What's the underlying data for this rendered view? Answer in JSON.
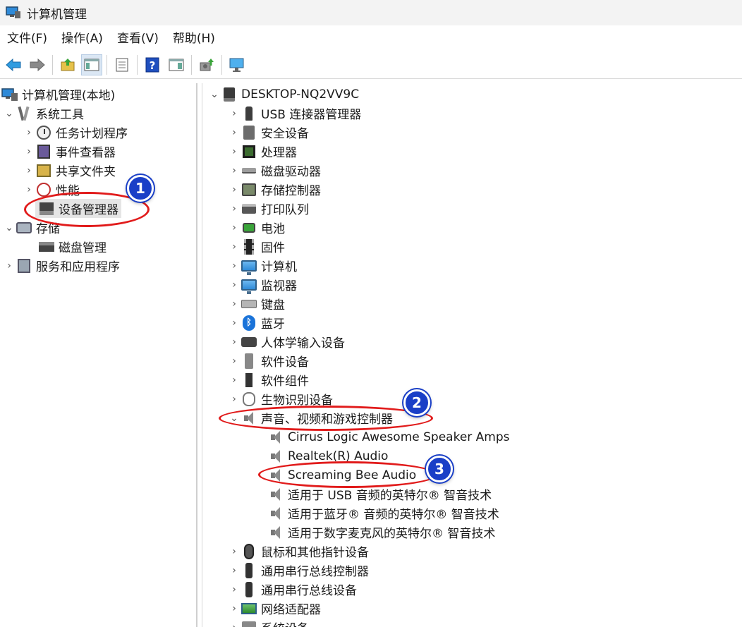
{
  "window": {
    "title": "计算机管理"
  },
  "menu": [
    "文件(F)",
    "操作(A)",
    "查看(V)",
    "帮助(H)"
  ],
  "left_tree": {
    "root": "计算机管理(本地)",
    "system_tools": "系统工具",
    "task_scheduler": "任务计划程序",
    "event_viewer": "事件查看器",
    "shared_folders": "共享文件夹",
    "performance": "性能",
    "device_manager": "设备管理器",
    "storage": "存储",
    "disk_management": "磁盘管理",
    "services_apps": "服务和应用程序"
  },
  "device_tree": {
    "host": "DESKTOP-NQ2VV9C",
    "categories": [
      "USB 连接器管理器",
      "安全设备",
      "处理器",
      "磁盘驱动器",
      "存储控制器",
      "打印队列",
      "电池",
      "固件",
      "计算机",
      "监视器",
      "键盘",
      "蓝牙",
      "人体学输入设备",
      "软件设备",
      "软件组件",
      "生物识别设备",
      "声音、视频和游戏控制器"
    ],
    "audio_devices": [
      "Cirrus Logic Awesome Speaker Amps",
      "Realtek(R) Audio",
      "Screaming Bee Audio",
      "适用于 USB 音频的英特尔® 智音技术",
      "适用于蓝牙® 音频的英特尔® 智音技术",
      "适用于数字麦克风的英特尔® 智音技术"
    ],
    "after": [
      "鼠标和其他指针设备",
      "通用串行总线控制器",
      "通用串行总线设备",
      "网络适配器",
      "系统设备"
    ]
  },
  "annotations": [
    "1",
    "2",
    "3"
  ],
  "colors": {
    "annotation_ring": "#e11b1b",
    "badge": "#1a3fc7"
  }
}
